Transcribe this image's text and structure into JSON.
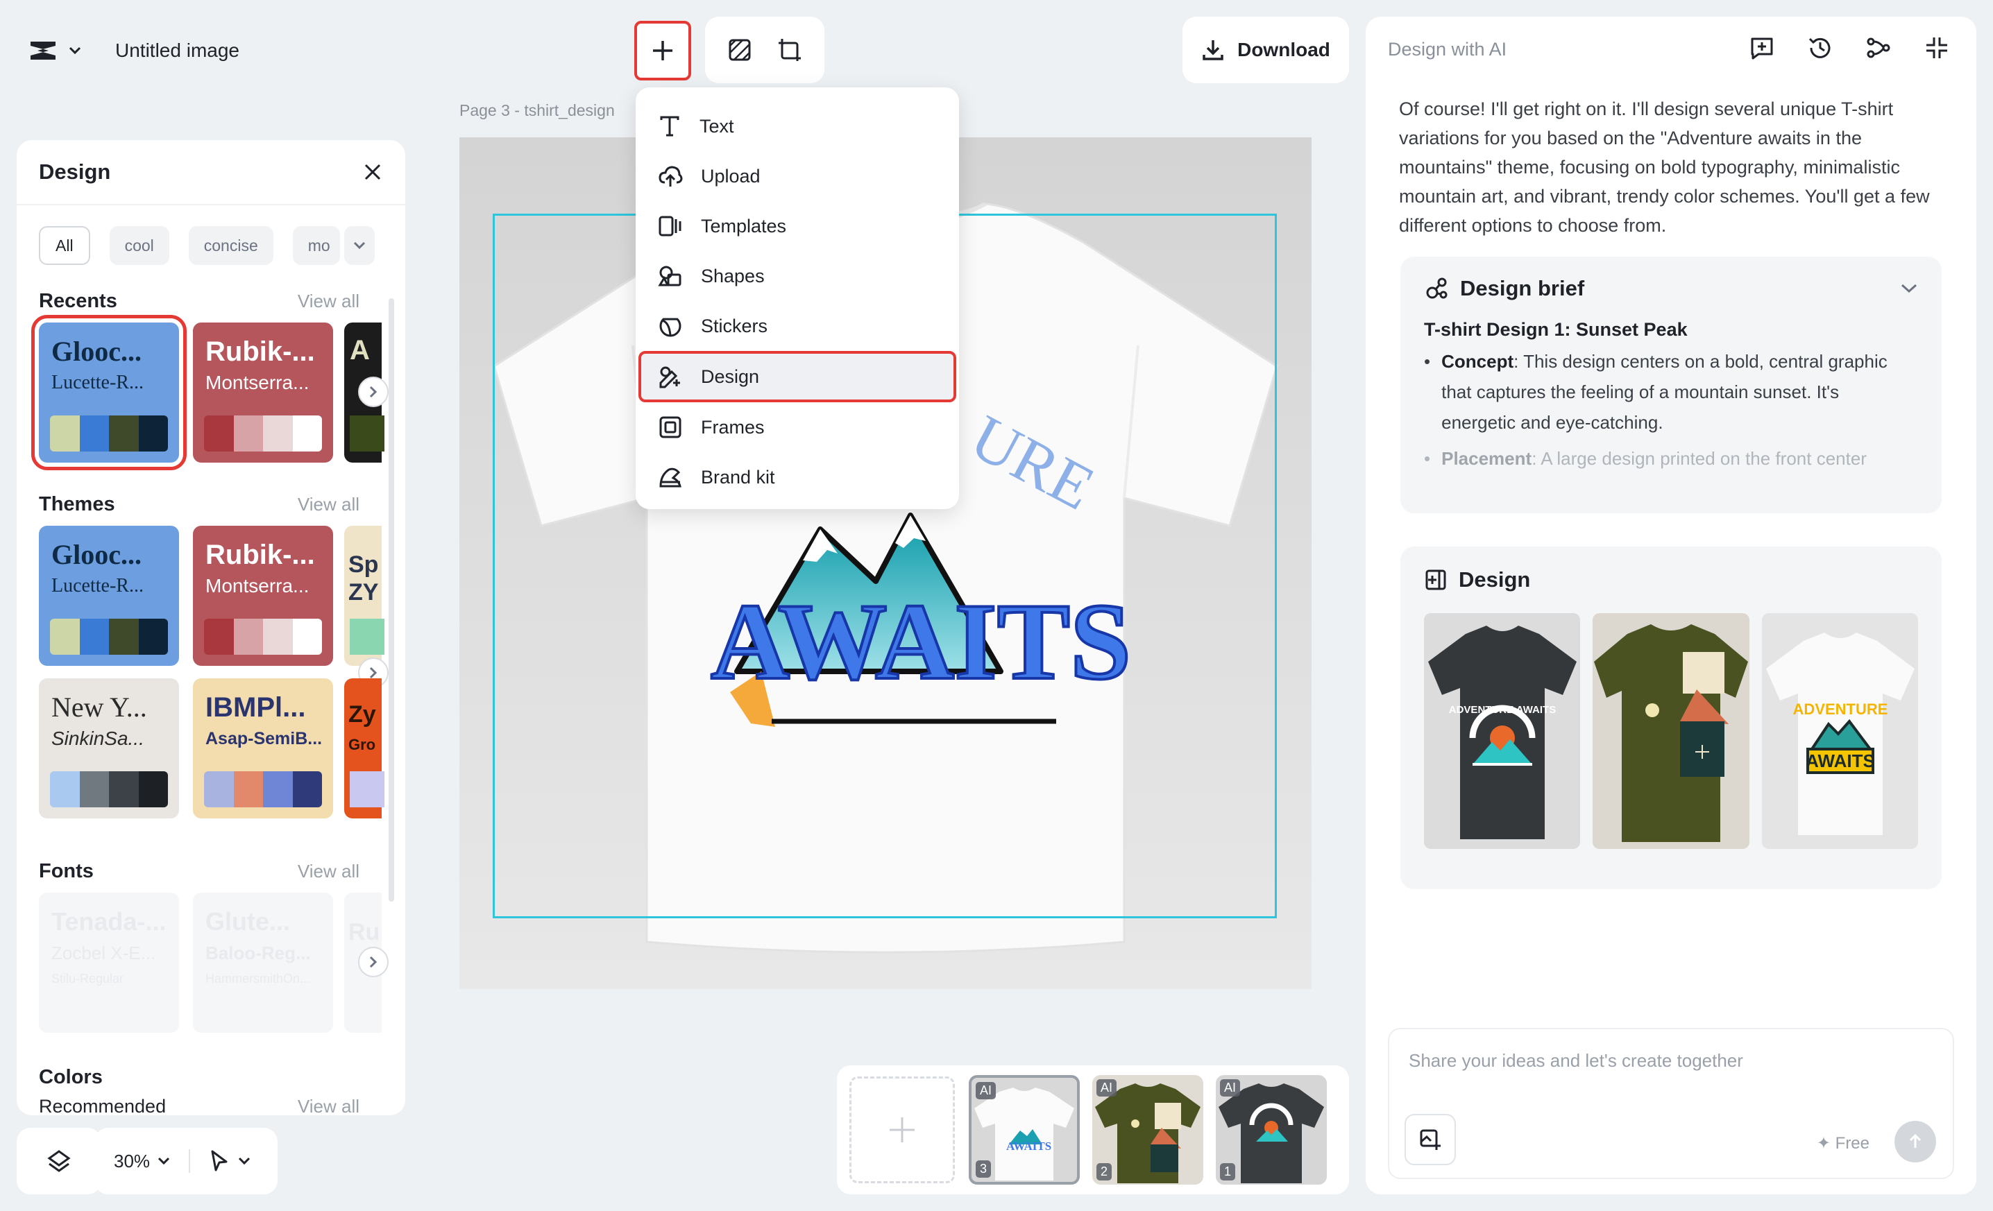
{
  "header": {
    "doc_title": "Untitled image",
    "download_label": "Download"
  },
  "canvas": {
    "page_label": "Page 3 -   tshirt_design",
    "shirt_text_arc": "URE",
    "shirt_text_main": "AWAITS"
  },
  "add_menu": {
    "items": [
      {
        "label": "Text",
        "icon": "text-icon"
      },
      {
        "label": "Upload",
        "icon": "upload-cloud-icon"
      },
      {
        "label": "Templates",
        "icon": "templates-icon"
      },
      {
        "label": "Shapes",
        "icon": "shapes-icon"
      },
      {
        "label": "Stickers",
        "icon": "sticker-icon"
      },
      {
        "label": "Design",
        "icon": "design-icon",
        "highlighted": true
      },
      {
        "label": "Frames",
        "icon": "frame-icon"
      },
      {
        "label": "Brand kit",
        "icon": "brand-kit-icon"
      }
    ]
  },
  "left_panel": {
    "title": "Design",
    "chips": [
      "All",
      "cool",
      "concise",
      "mo"
    ],
    "recents": {
      "title": "Recents",
      "view_all": "View all",
      "tiles": [
        {
          "t1": "Glooc...",
          "t2": "Lucette-R...",
          "bg": "#6c9ee0",
          "fg": "#0f2a44",
          "colors": [
            "#ccd6a6",
            "#3a7bd5",
            "#3f4a2a",
            "#0d2438"
          ]
        },
        {
          "t1": "Rubik-...",
          "t2": "Montserra...",
          "bg": "#b5555c",
          "fg": "#ffffff",
          "colors": [
            "#a8383d",
            "#d7a3a6",
            "#ead7d8",
            "#ffffff"
          ]
        },
        {
          "t1": "A",
          "t2": "",
          "bg": "#1c1c1c",
          "fg": "#e0e0c0",
          "colors": []
        }
      ]
    },
    "themes": {
      "title": "Themes",
      "view_all": "View all",
      "row1": [
        {
          "t1": "Glooc...",
          "t2": "Lucette-R...",
          "bg": "#6c9ee0",
          "fg": "#0f2a44",
          "colors": [
            "#ccd6a6",
            "#3a7bd5",
            "#3f4a2a",
            "#0d2438"
          ]
        },
        {
          "t1": "Rubik-...",
          "t2": "Montserra...",
          "bg": "#b5555c",
          "fg": "#ffffff",
          "colors": [
            "#a8383d",
            "#d7a3a6",
            "#ead7d8",
            "#ffffff"
          ]
        },
        {
          "t1": "Sp",
          "t2": "ZY",
          "bg": "#efe3c8",
          "fg": "#2a3550",
          "colors": []
        }
      ],
      "row2": [
        {
          "t1": "New Y...",
          "t2": "SinkinSa...",
          "bg": "#e9e5e0",
          "fg": "#2b2b2b",
          "colors": [
            "#a9c9f0",
            "#707880",
            "#3d4248",
            "#1d2024"
          ]
        },
        {
          "t1": "IBMPl...",
          "t2": "Asap-SemiB...",
          "bg": "#f3dcae",
          "fg": "#2a3570",
          "colors": [
            "#a8b3e0",
            "#e2896b",
            "#6f86d6",
            "#2e3a7a"
          ]
        },
        {
          "t1": "Zy",
          "t2": "Gro",
          "bg": "#e4531d",
          "fg": "#2a1608",
          "colors": []
        }
      ]
    },
    "fonts": {
      "title": "Fonts",
      "view_all": "View all",
      "tiles": [
        {
          "t1": "Tenada-...",
          "t2": "Zocbel X-E...",
          "t3": "Stilu-Regular"
        },
        {
          "t1": "Glute...",
          "t2": "Baloo-Reg...",
          "t3": "HammersmithOn..."
        },
        {
          "t1": "Ru",
          "t2": "",
          "t3": ""
        }
      ]
    },
    "colors": {
      "title": "Colors",
      "subtitle": "Recommended",
      "view_all": "View all"
    }
  },
  "bottom_left": {
    "zoom": "30%"
  },
  "right_panel": {
    "title": "Design with AI",
    "message": "Of course! I'll get right on it. I'll design several unique T-shirt variations for you based on the \"Adventure awaits in the mountains\" theme, focusing on bold typography, minimalistic mountain art, and vibrant, trendy color schemes. You'll get a few different options to choose from.",
    "brief": {
      "title": "Design brief",
      "subtitle": "T-shirt Design 1: Sunset Peak",
      "concept_label": "Concept",
      "concept_text": ": This design centers on a bold, central graphic that captures the feeling of a mountain sunset. It's energetic and eye-catching.",
      "placement_label": "Placement",
      "placement_text": ": A large design printed on the front center"
    },
    "design_card_title": "Design",
    "design_thumb_texts": [
      "ADVENTURE AWAITS",
      "ADVENTURE",
      "AWAITS"
    ],
    "chat_placeholder": "Share your ideas and let's create together",
    "free_label": "✦ Free"
  },
  "filmstrip": {
    "pages": [
      {
        "badge": "AI",
        "num": "3",
        "selected": true,
        "shirt": "white"
      },
      {
        "badge": "AI",
        "num": "2",
        "selected": false,
        "shirt": "olive"
      },
      {
        "badge": "AI",
        "num": "1",
        "selected": false,
        "shirt": "dark"
      }
    ],
    "thumb_text": "AWAITS"
  },
  "colors": {
    "accent_red": "#e53935",
    "selection_cyan": "#2ec4d9"
  }
}
